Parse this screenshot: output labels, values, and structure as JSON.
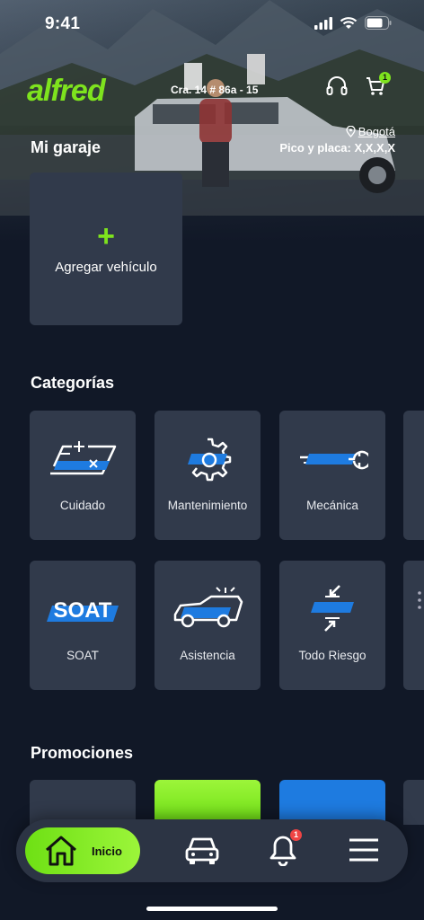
{
  "status": {
    "time": "9:41"
  },
  "header": {
    "logo": "alfred",
    "address": "Cra. 14 # 86a - 15",
    "cart_count": "1",
    "city": "Bogotá",
    "pico_y_placa": "Pico y placa: X,X,X,X"
  },
  "garage": {
    "title": "Mi garaje",
    "add_label": "Agregar vehículo",
    "add_symbol": "+"
  },
  "categories": {
    "title": "Categorías",
    "items": [
      {
        "label": "Cuidado",
        "icon": "car-care-icon"
      },
      {
        "label": "Mantenimiento",
        "icon": "gear-icon"
      },
      {
        "label": "Mecánica",
        "icon": "wrench-icon"
      },
      {
        "label": "SOAT",
        "icon": "soat-icon",
        "icon_text": "SOAT"
      },
      {
        "label": "Asistencia",
        "icon": "roadside-assistance-icon"
      },
      {
        "label": "Todo Riesgo",
        "icon": "collision-icon"
      }
    ]
  },
  "promotions": {
    "title": "Promociones"
  },
  "nav": {
    "home_label": "Inicio",
    "notifications_count": "1"
  },
  "colors": {
    "accent": "#7ee31e",
    "card": "#313a4b",
    "background": "#111827",
    "blue": "#1e7be0"
  }
}
